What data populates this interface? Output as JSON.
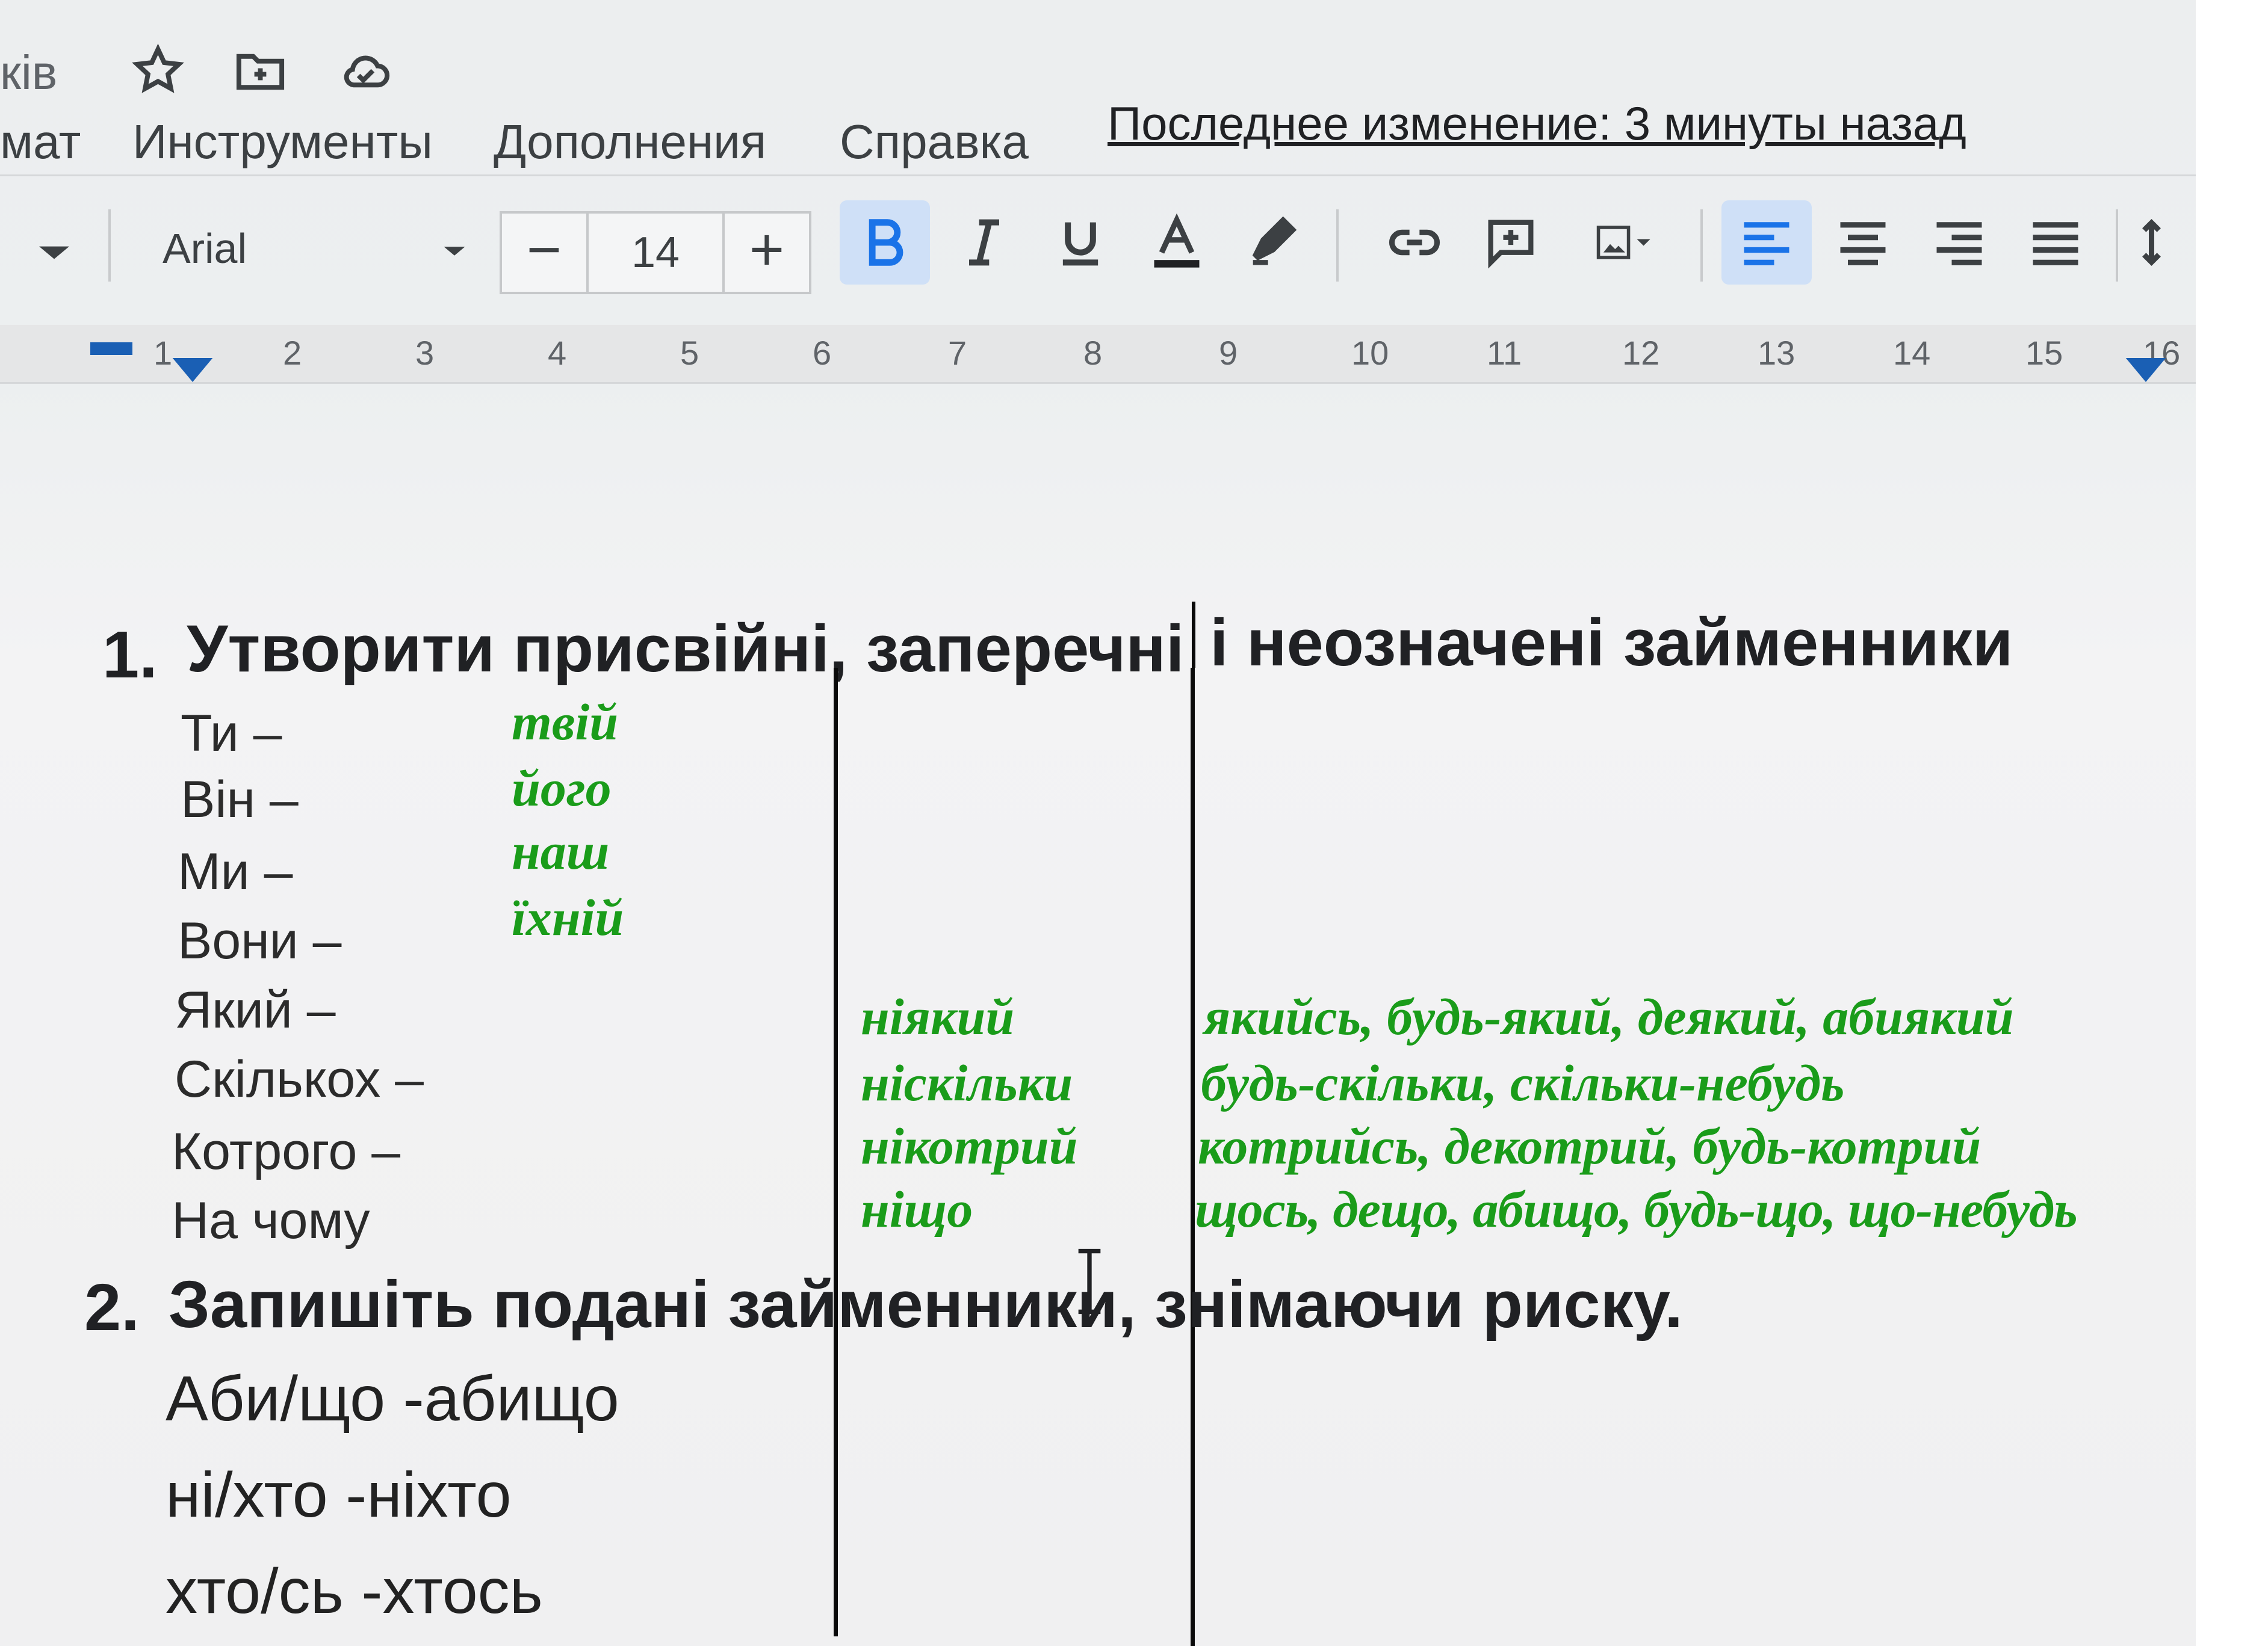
{
  "title_bar": {
    "title_fragment": "ків",
    "icons": [
      "star-icon",
      "move-to-folder-icon",
      "cloud-saved-icon"
    ]
  },
  "menu": {
    "items": [
      "мат",
      "Инструменты",
      "Дополнения",
      "Справка"
    ],
    "last_edit": "Последнее изменение: 3 минуты назад"
  },
  "toolbar": {
    "font": "Arial",
    "font_size": "14",
    "minus": "−",
    "plus": "+",
    "buttons": [
      "bold",
      "italic",
      "underline",
      "text-color",
      "highlight",
      "link",
      "comment",
      "image",
      "align-left",
      "align-center",
      "align-right",
      "justify"
    ],
    "active_buttons": [
      "bold",
      "align-left"
    ],
    "colors": {
      "accent": "#1a73e8",
      "active_bg": "#cfe0f7"
    }
  },
  "ruler": {
    "numbers": [
      "1",
      "2",
      "3",
      "4",
      "5",
      "6",
      "7",
      "8",
      "9",
      "10",
      "11",
      "12",
      "13",
      "14",
      "15",
      "16"
    ]
  },
  "document": {
    "task1": {
      "number": "1.",
      "heading_part1": "Утворити присвійні, заперечні",
      "heading_part2": "і неозначені займенники",
      "rows": [
        {
          "pronoun": "Ти –",
          "possessive": "твій",
          "negative": "",
          "indefinite": ""
        },
        {
          "pronoun": "Він –",
          "possessive": "його",
          "negative": "",
          "indefinite": ""
        },
        {
          "pronoun": "Ми –",
          "possessive": "наш",
          "negative": "",
          "indefinite": ""
        },
        {
          "pronoun": "Вони –",
          "possessive": "їхній",
          "negative": "",
          "indefinite": ""
        },
        {
          "pronoun": "Який –",
          "possessive": "",
          "negative": "ніякий",
          "indefinite": "якийсь, будь-який, деякий, абиякий"
        },
        {
          "pronoun": "Скількох –",
          "possessive": "",
          "negative": "ніскільки",
          "indefinite": "будь-скільки, скільки-небудь"
        },
        {
          "pronoun": "Котрого –",
          "possessive": "",
          "negative": "нікотрий",
          "indefinite": "котрийсь, декотрий, будь-котрий"
        },
        {
          "pronoun": "На чому",
          "possessive": "",
          "negative": "ніщо",
          "indefinite": "щось, дещо, абищо, будь-що, що-небудь"
        }
      ],
      "answer_color": "#1a9c1a"
    },
    "task2": {
      "number": "2.",
      "heading": "Запишіть подані займенники, знімаючи риску.",
      "examples": [
        "Аби/що -абищо",
        "ні/хто -ніхто",
        "хто/сь -хтось"
      ]
    }
  }
}
